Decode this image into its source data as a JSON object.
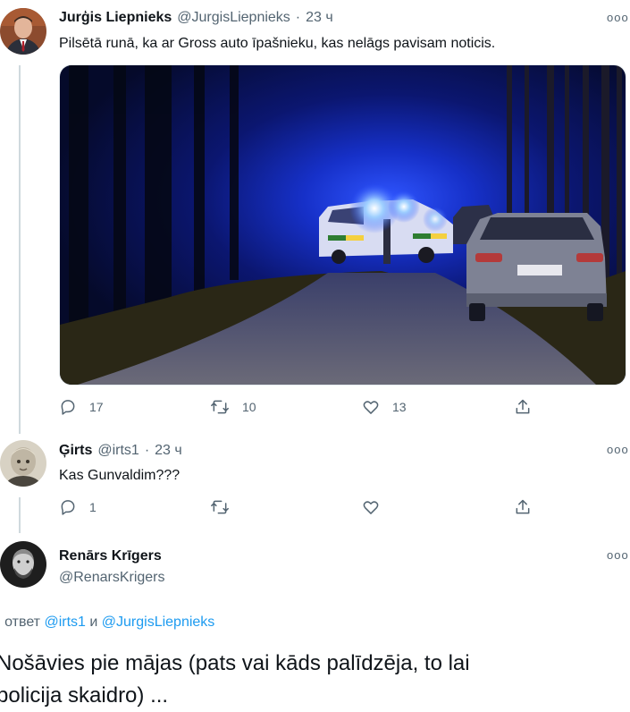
{
  "tweet1": {
    "name": "Jurģis Liepnieks",
    "handle": "@JurgisLiepnieks",
    "separator": "·",
    "time": "23 ч",
    "more": "ooo",
    "text": "Pilsētā runā, ka ar Gross auto īpašnieku, kas nelāgs pavisam noticis.",
    "replies": "17",
    "retweets": "10",
    "likes": "13"
  },
  "tweet2": {
    "name": "Ģirts",
    "handle": "@irts1",
    "separator": "·",
    "time": "23 ч",
    "more": "ooo",
    "text": "Kas Gunvaldim???",
    "replies": "1",
    "retweets": "",
    "likes": ""
  },
  "tweet3": {
    "name": "Renārs Krīgers",
    "handle": "@RenarsKrigers",
    "more": "ooo",
    "reply_prefix": "В ответ",
    "reply_user1": "@irts1",
    "reply_conj": "и",
    "reply_user2": "@JurgisLiepnieks",
    "text_line1": "Nošāvies pie mājas (pats vai kāds palīdzēja, to lai",
    "text_line2": "policija skaidro) ..."
  },
  "colors": {
    "link": "#1d9bf0",
    "muted": "#536471",
    "thread_line": "#cfd9de",
    "night_blue": "#0a1a6e"
  },
  "icons": [
    "reply-icon",
    "retweet-icon",
    "like-icon",
    "share-icon",
    "more-icon"
  ]
}
